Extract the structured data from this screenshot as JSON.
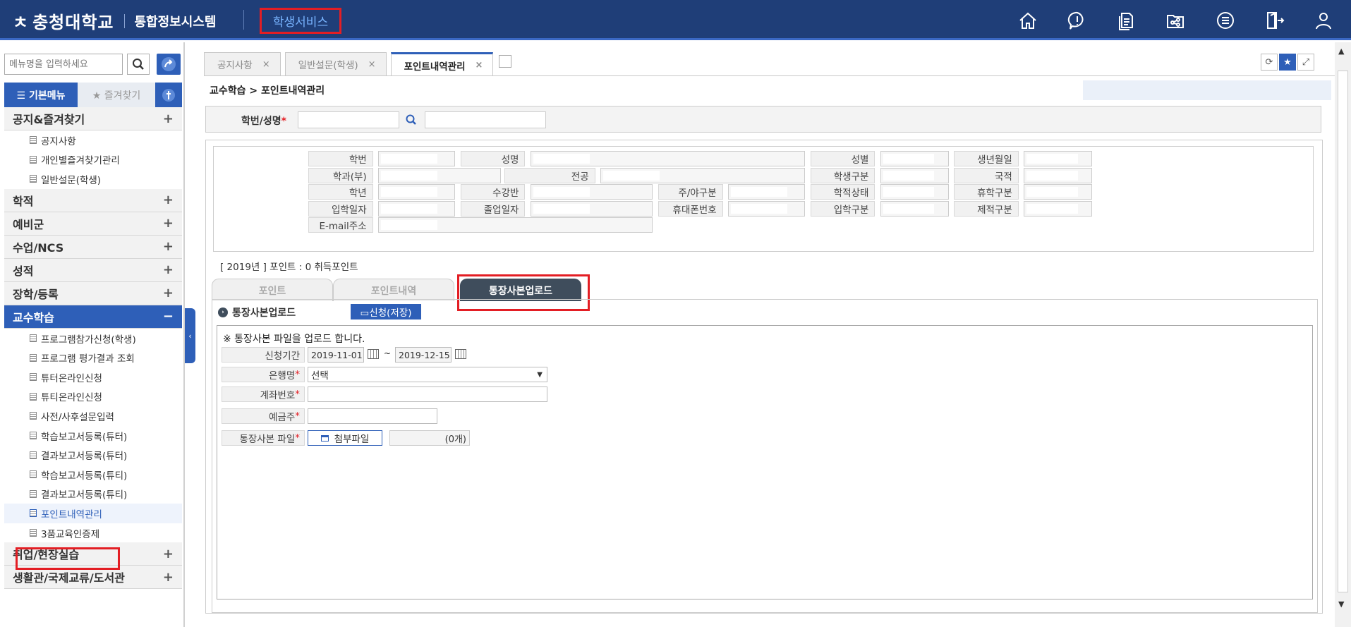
{
  "header": {
    "logo_mark": "ㅊ",
    "university": "충청대학교",
    "system": "통합정보시스템",
    "service": "학생서비스",
    "icons": [
      "home-icon",
      "notice-icon",
      "documents-icon",
      "share-icon",
      "menu-icon",
      "logout-icon",
      "user-icon"
    ]
  },
  "sidebar": {
    "search_placeholder": "메뉴명을 입력하세요",
    "tab_basic": "☰ 기본메뉴",
    "tab_fav": "★ 즐겨찾기",
    "categories": [
      {
        "label": "공지&즐겨찾기",
        "toggle": "+",
        "items": [
          "공지사항",
          "개인별즐겨찾기관리",
          "일반설문(학생)"
        ]
      },
      {
        "label": "학적",
        "toggle": "+"
      },
      {
        "label": "예비군",
        "toggle": "+"
      },
      {
        "label": "수업/NCS",
        "toggle": "+"
      },
      {
        "label": "성적",
        "toggle": "+"
      },
      {
        "label": "장학/등록",
        "toggle": "+"
      },
      {
        "label": "교수학습",
        "toggle": "−",
        "items": [
          "프로그램참가신청(학생)",
          "프로그램 평가결과 조회",
          "튜터온라인신청",
          "튜티온라인신청",
          "사전/사후설문입력",
          "학습보고서등록(튜터)",
          "결과보고서등록(튜터)",
          "학습보고서등록(튜티)",
          "결과보고서등록(튜티)",
          "포인트내역관리",
          "3품교육인증제"
        ]
      },
      {
        "label": "취업/현장실습",
        "toggle": "+"
      },
      {
        "label": "생활관/국제교류/도서관",
        "toggle": "+"
      }
    ]
  },
  "tabs": [
    {
      "label": "공지사항",
      "close": "×"
    },
    {
      "label": "일반설문(학생)",
      "close": "×"
    },
    {
      "label": "포인트내역관리",
      "close": "×"
    }
  ],
  "breadcrumb": "교수학습 > 포인트내역관리",
  "search": {
    "label": "학번/성명",
    "req": "*"
  },
  "info": {
    "labels": [
      "학번",
      "성명",
      "성별",
      "생년월일",
      "학과(부)",
      "전공",
      "학생구분",
      "국적",
      "학년",
      "수강반",
      "주/야구분",
      "학적상태",
      "휴학구분",
      "입학일자",
      "졸업일자",
      "휴대폰번호",
      "입학구분",
      "제적구분",
      "E-mail주소"
    ]
  },
  "points": {
    "text": "[   2019년  ] 포인트 : 0 취득포인트",
    "tabs": [
      "포인트",
      "포인트내역",
      "통장사본업로드"
    ]
  },
  "upload": {
    "title": "통장사본업로드",
    "apply": "▭신청(저장)",
    "note": "※ 통장사본 파일을 업로드 합니다.",
    "period_label": "신청기간",
    "period_start": "2019-11-01",
    "period_sep": "~",
    "period_end": "2019-12-15",
    "bank_label": "은행명",
    "bank_value": "선택",
    "account_label": "계좌번호",
    "holder_label": "예금주",
    "file_label": "통장사본 파일",
    "attach": "첨부파일",
    "count": "(0개)"
  }
}
